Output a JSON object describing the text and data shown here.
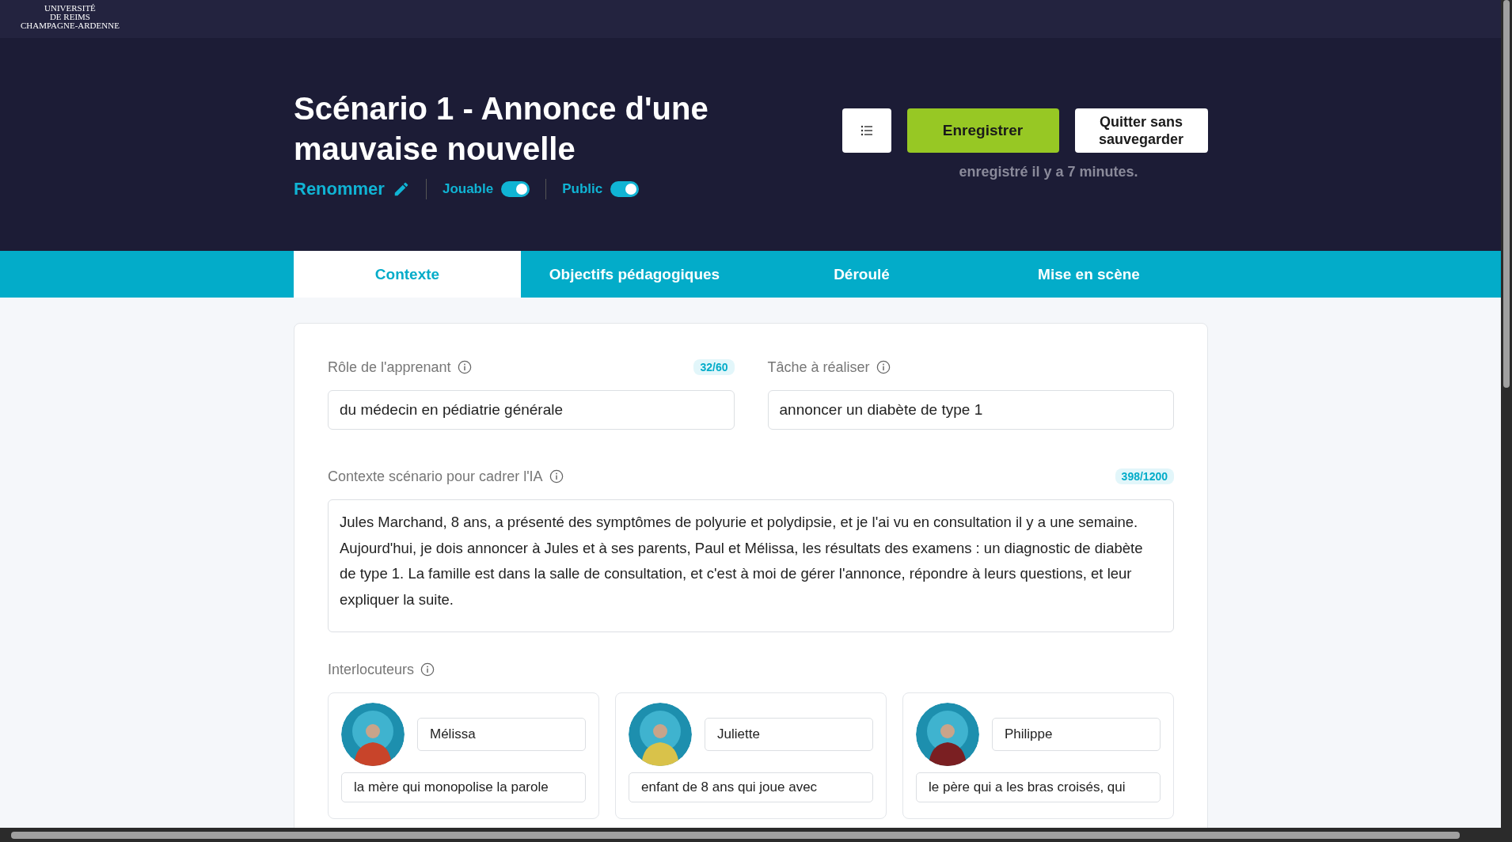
{
  "logo": {
    "lines": [
      "UNIVERSITÉ",
      "DE REIMS",
      "CHAMPAGNE-ARDENNE"
    ]
  },
  "header": {
    "title": "Scénario 1 - Annonce d'une mauvaise nouvelle",
    "rename": "Renommer",
    "toggles": [
      {
        "label": "Jouable",
        "on": true
      },
      {
        "label": "Public",
        "on": true
      }
    ],
    "save_button": "Enregistrer",
    "quit_button": "Quitter sans sauvegarder",
    "saved_status": "enregistré il y a 7 minutes."
  },
  "tabs": [
    {
      "label": "Contexte",
      "selected": true
    },
    {
      "label": "Objectifs pédagogiques",
      "selected": false
    },
    {
      "label": "Déroulé",
      "selected": false
    },
    {
      "label": "Mise en scène",
      "selected": false
    }
  ],
  "fields": [
    {
      "label": "Rôle de l'apprenant",
      "counter": "32/60",
      "value": "du médecin en pédiatrie générale"
    },
    {
      "label": "Tâche à réaliser",
      "value": "annoncer un diabète de type 1"
    }
  ],
  "context": {
    "label": "Contexte scénario pour cadrer l'IA",
    "counter": "398/1200",
    "value": "Jules Marchand, 8 ans, a présenté des symptômes de polyurie et polydipsie, et je l'ai vu en consultation il y a une semaine. Aujourd'hui, je dois annoncer à Jules et à ses parents, Paul et Mélissa, les résultats des examens : un diagnostic de diabète de type 1. La famille est dans la salle de consultation, et c'est à moi de gérer l'annonce, répondre à leurs questions, et leur expliquer la suite."
  },
  "interlocutors": {
    "label": "Interlocuteurs",
    "items": [
      {
        "name": "Mélissa",
        "description": "la mère qui monopolise la parole",
        "color": "#c8442a"
      },
      {
        "name": "Juliette",
        "description": "enfant de 8 ans qui joue avec",
        "color": "#d9c24a"
      },
      {
        "name": "Philippe",
        "description": "le père qui a les bras croisés, qui",
        "color": "#7a1f22"
      }
    ]
  }
}
